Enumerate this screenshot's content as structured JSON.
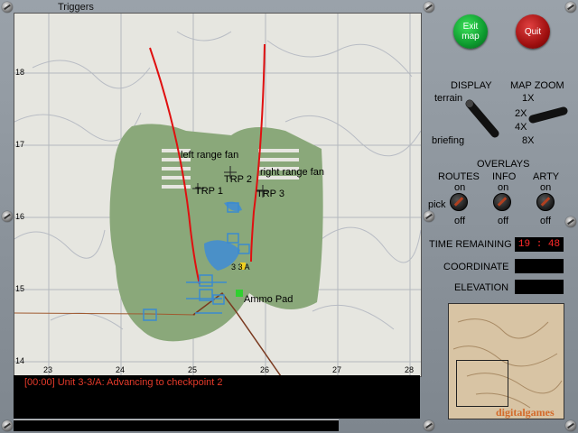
{
  "map": {
    "title": "Triggers",
    "labels": {
      "left_fan": "left range fan",
      "right_fan": "right range fan",
      "trp1": "TRP 1",
      "trp2": "TRP 2",
      "trp3": "TRP 3",
      "ammo": "Ammo Pad",
      "unit_3_3a": "3 3 A"
    },
    "grid_x": [
      "23",
      "24",
      "25",
      "26",
      "27",
      "28"
    ],
    "grid_y": [
      "18",
      "17",
      "16",
      "15",
      "14"
    ],
    "colors": {
      "forest": "#8aa87a",
      "road": "#7a3a20",
      "fan": "#e01010",
      "unit": "#3a8ad0"
    }
  },
  "message_log": {
    "line1": "[00:00] Unit 3-3/A: Advancing to checkpoint 2"
  },
  "buttons": {
    "exit": "Exit map",
    "quit": "Quit"
  },
  "display": {
    "title": "DISPLAY",
    "option_terrain": "terrain",
    "option_briefing": "briefing"
  },
  "map_zoom": {
    "title": "MAP ZOOM",
    "z1": "1X",
    "z2": "2X",
    "z4": "4X",
    "z8": "8X"
  },
  "overlays": {
    "title": "OVERLAYS",
    "routes": "ROUTES",
    "info": "INFO",
    "arty": "ARTY",
    "on": "on",
    "off": "off",
    "pick": "pick"
  },
  "status": {
    "time_label": "TIME REMAINING",
    "time_value": "19 : 48",
    "coord_label": "COORDINATE",
    "coord_value": "",
    "elev_label": "ELEVATION",
    "elev_value": ""
  },
  "logo": "digitalgames"
}
